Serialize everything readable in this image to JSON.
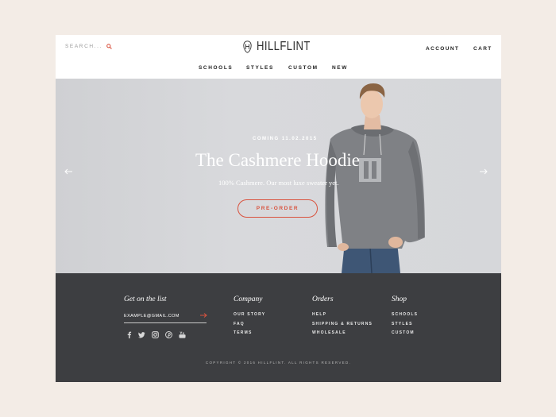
{
  "header": {
    "search_label": "SEARCH...",
    "brand": "HILLFLINT",
    "account": "ACCOUNT",
    "cart": "CART"
  },
  "nav": {
    "items": [
      "SCHOOLS",
      "STYLES",
      "CUSTOM",
      "NEW"
    ]
  },
  "hero": {
    "eyebrow": "COMING 11.02.2015",
    "title": "The Cashmere Hoodie",
    "subtitle": "100% Cashmere. Our most luxe sweater yet.",
    "cta": "PRE-ORDER"
  },
  "footer": {
    "newsletter_heading": "Get on the list",
    "email_value": "EXAMPLE@GMAIL.COM",
    "social_icons": [
      "facebook-icon",
      "twitter-icon",
      "instagram-icon",
      "pinterest-icon",
      "youtube-icon"
    ],
    "columns": [
      {
        "heading": "Company",
        "links": [
          "OUR STORY",
          "FAQ",
          "TERMS"
        ]
      },
      {
        "heading": "Orders",
        "links": [
          "HELP",
          "SHIPPING & RETURNS",
          "WHOLESALE"
        ]
      },
      {
        "heading": "Shop",
        "links": [
          "SCHOOLS",
          "STYLES",
          "CUSTOM"
        ]
      }
    ],
    "copyright": "COPYRIGHT © 2016 HILLFLINT. ALL RIGHTS RESERVED."
  },
  "colors": {
    "accent": "#d9533f",
    "footer_bg": "#3d3e41",
    "page_bg": "#f3ece6"
  }
}
